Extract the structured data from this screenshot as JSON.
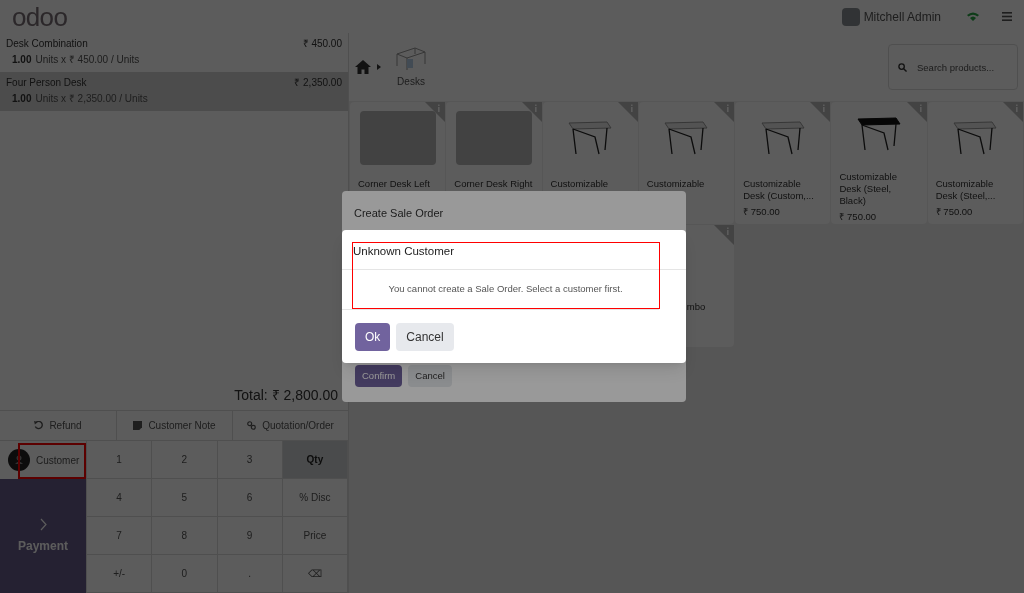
{
  "header": {
    "logo": "odoo",
    "user": "Mitchell Admin"
  },
  "orderlines": [
    {
      "name": "Desk Combination",
      "price": "₹ 450.00",
      "qty": "1.00",
      "unit_info": "Units x ₹ 450.00 / Units",
      "selected": false
    },
    {
      "name": "Four Person Desk",
      "price": "₹ 2,350.00",
      "qty": "1.00",
      "unit_info": "Units x ₹ 2,350.00 / Units",
      "selected": true
    }
  ],
  "total": "Total: ₹ 2,800.00",
  "control_buttons": [
    {
      "kind": "refund",
      "label": "Refund"
    },
    {
      "kind": "note",
      "label": "Customer Note"
    },
    {
      "kind": "link",
      "label": "Quotation/Order"
    }
  ],
  "customer_button": {
    "label": "Customer",
    "highlighted": true
  },
  "payment_button": {
    "label": "Payment"
  },
  "numpad": [
    {
      "label": "1",
      "selected": false
    },
    {
      "label": "2",
      "selected": false
    },
    {
      "label": "3",
      "selected": false
    },
    {
      "label": "Qty",
      "selected": true
    },
    {
      "label": "4",
      "selected": false
    },
    {
      "label": "5",
      "selected": false
    },
    {
      "label": "6",
      "selected": false
    },
    {
      "label": "% Disc",
      "selected": false
    },
    {
      "label": "7",
      "selected": false
    },
    {
      "label": "8",
      "selected": false
    },
    {
      "label": "9",
      "selected": false
    },
    {
      "label": "Price",
      "selected": false
    },
    {
      "label": "+/-",
      "selected": false
    },
    {
      "label": "0",
      "selected": false
    },
    {
      "label": ".",
      "selected": false
    },
    {
      "label": "⌫",
      "selected": false
    }
  ],
  "breadcrumb": {
    "category": "Desks"
  },
  "search": {
    "placeholder": "Search products..."
  },
  "products": [
    {
      "kind": "photo",
      "name": "Corner Desk Left"
    },
    {
      "kind": "photo",
      "name": "Corner Desk Right"
    },
    {
      "kind": "table-light",
      "name": "Customizable"
    },
    {
      "kind": "table-light",
      "name": "Customizable"
    },
    {
      "kind": "table-light",
      "name": "Customizable Desk (Custom,...",
      "price": "₹ 750.00"
    },
    {
      "kind": "table-dark",
      "name": "Customizable Desk (Steel, Black)",
      "price": "₹ 750.00"
    },
    {
      "kind": "table-light",
      "name": "Customizable Desk (Steel,...",
      "price": "₹ 750.00"
    },
    {
      "kind": "hidden"
    },
    {
      "kind": "hidden"
    },
    {
      "kind": "hidden"
    },
    {
      "kind": "partial",
      "name": "mbo"
    }
  ],
  "sale_order_dialog": {
    "title": "Create Sale Order",
    "buttons": [
      {
        "kind": "primary",
        "label": "Confirm"
      },
      {
        "kind": "secondary",
        "label": "Cancel"
      }
    ]
  },
  "alert": {
    "title": "Unknown Customer",
    "message": "You cannot create a Sale Order. Select a customer first.",
    "highlighted": true,
    "buttons": [
      {
        "kind": "primary",
        "label": "Ok"
      },
      {
        "kind": "secondary",
        "label": "Cancel"
      }
    ]
  }
}
